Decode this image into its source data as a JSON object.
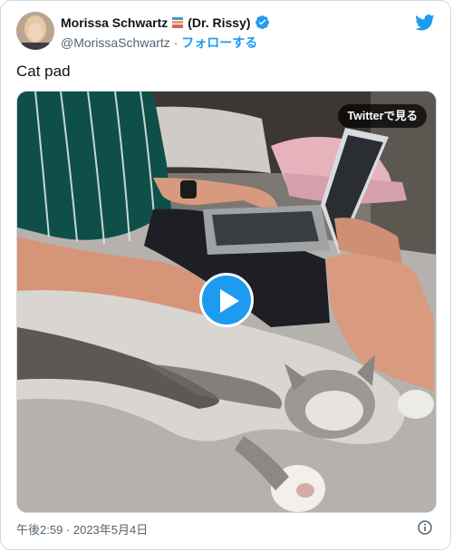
{
  "author": {
    "display_name": "Morissa Schwartz",
    "display_name_suffix": "(Dr. Rissy)",
    "handle": "@MorissaSchwartz",
    "separator": "·",
    "follow_label": "フォローする"
  },
  "tweet": {
    "text": "Cat pad"
  },
  "media": {
    "watch_on_twitter_label": "Twitterで見る"
  },
  "footer": {
    "timestamp": "午後2:59 · 2023年5月4日"
  },
  "icons": {
    "twitter_logo": "twitter-bird-icon",
    "verified": "verified-badge-icon",
    "books_emoji": "books-icon",
    "play": "play-icon",
    "info": "info-icon"
  },
  "colors": {
    "accent": "#1d9bf0",
    "text_primary": "#0f1419",
    "text_secondary": "#536471",
    "border": "#cfd9de"
  }
}
